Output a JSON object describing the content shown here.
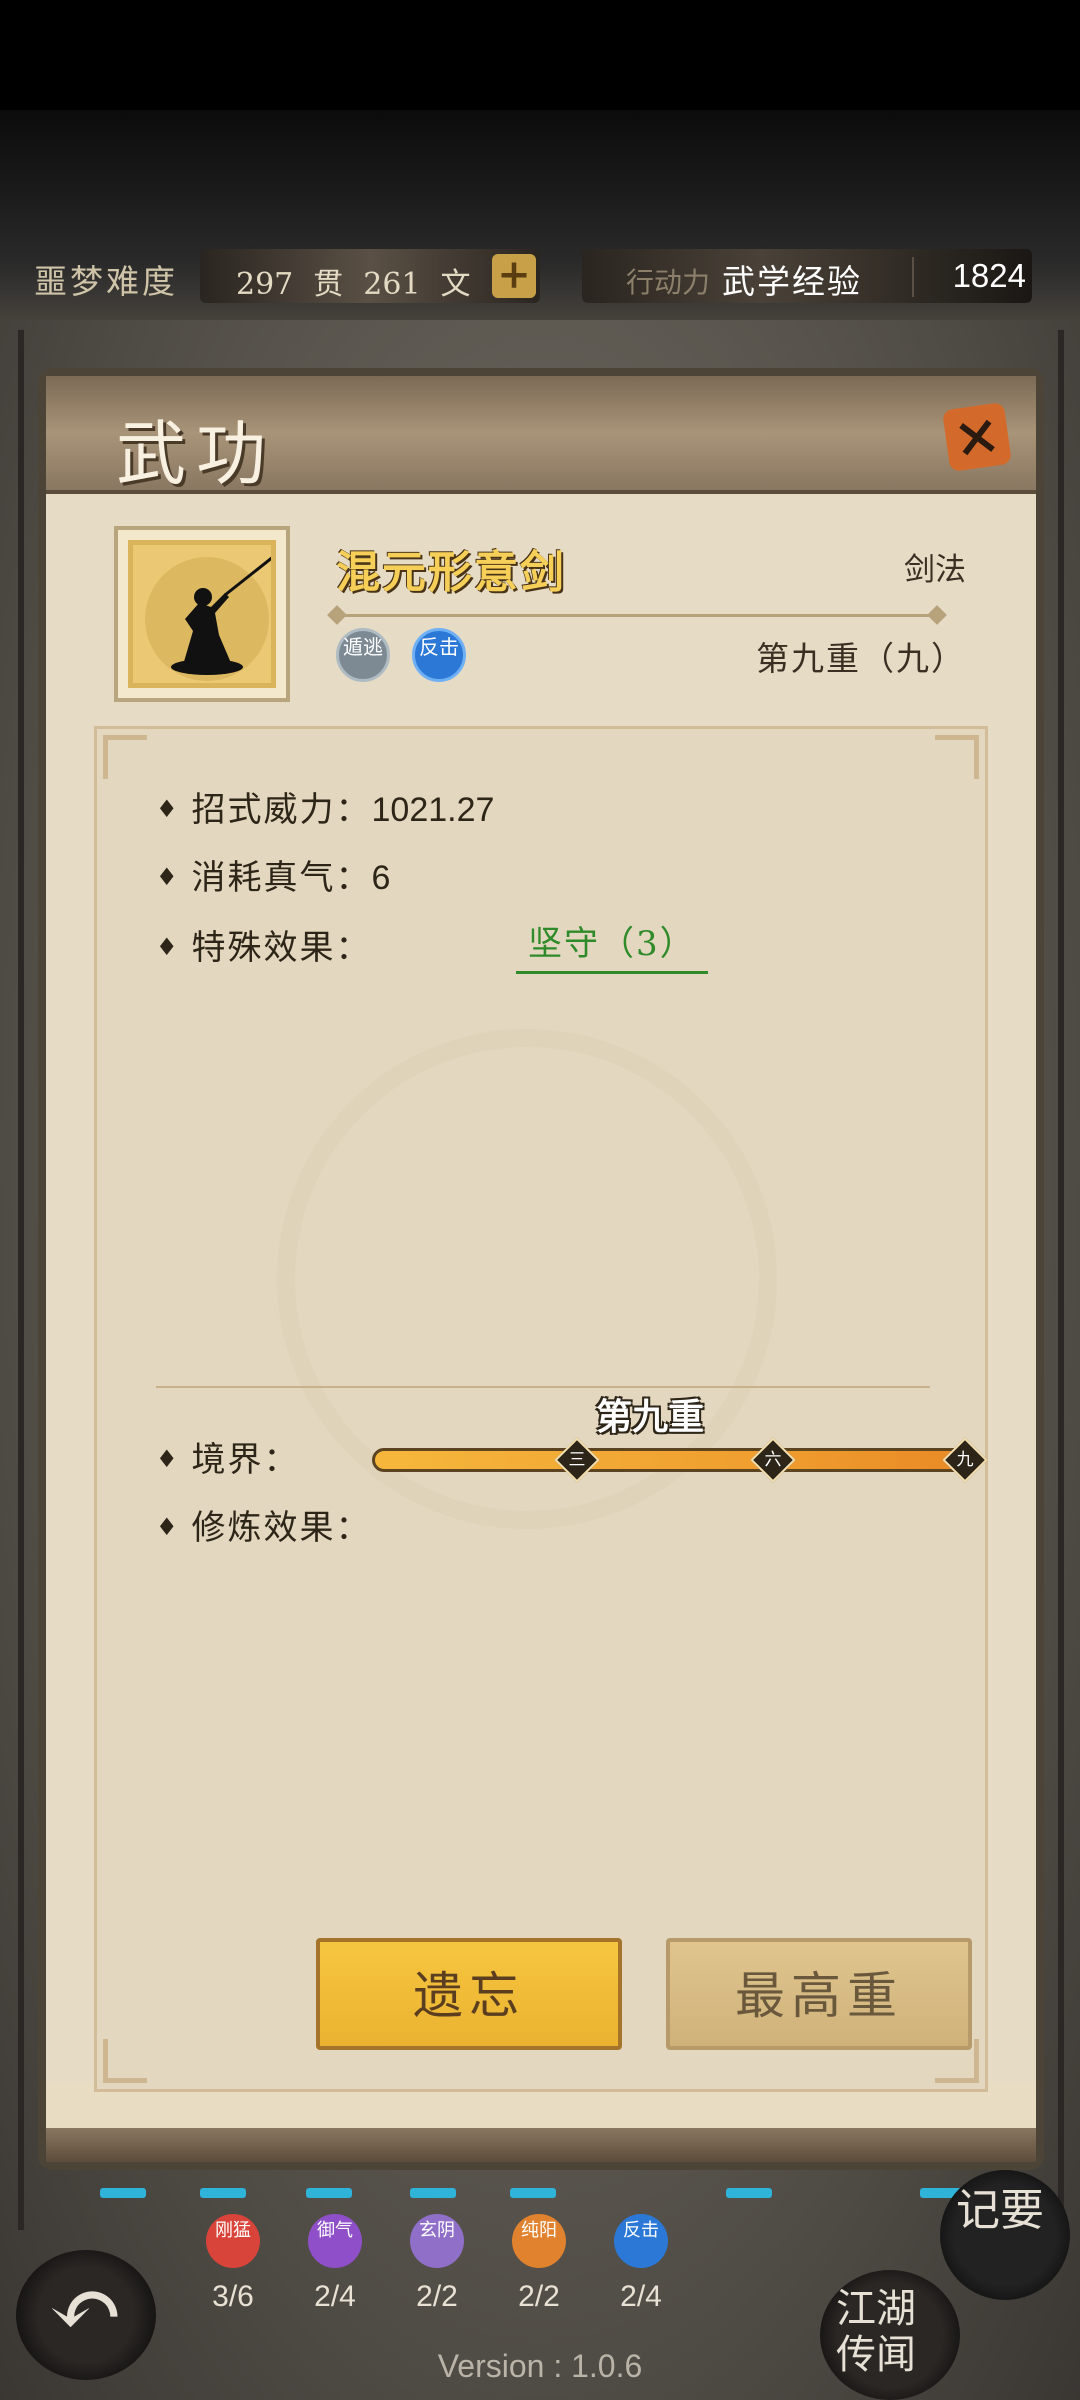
{
  "status_bar": {
    "difficulty": "噩梦难度",
    "money_guan": "297",
    "guan_unit": "贯",
    "money_wen": "261",
    "wen_unit": "文",
    "plus_label": "+",
    "action_label": "行动力",
    "exp_label": "武学经验",
    "exp_value": "1824"
  },
  "modal": {
    "title": "武功",
    "close_label": "×",
    "skill": {
      "name": "混元形意剑",
      "type": "剑法",
      "tags": [
        "遁逃",
        "反击"
      ],
      "level_text": "第九重（九）"
    },
    "stats": {
      "power_label": "招式威力：",
      "power_value": "1021.27",
      "cost_label": "消耗真气：",
      "cost_value": "6",
      "effect_label": "特殊效果：",
      "effect_value": "坚守（3）"
    },
    "realm": {
      "label": "境界：",
      "current": "第九重",
      "progress": 1.0,
      "ticks": [
        "三",
        "六",
        "九"
      ]
    },
    "training_label": "修炼效果：",
    "buttons": {
      "forget": "遗忘",
      "max": "最高重"
    }
  },
  "bottom_bar": {
    "tags": [
      {
        "name": "刚猛",
        "count": "3/6",
        "color": "#d8443a"
      },
      {
        "name": "御气",
        "count": "2/4",
        "color": "#8f4fc8"
      },
      {
        "name": "玄阴",
        "count": "2/2",
        "color": "#8f6fc8"
      },
      {
        "name": "纯阳",
        "count": "2/2",
        "color": "#e0822e"
      },
      {
        "name": "反击",
        "count": "2/4",
        "color": "#2b78d6"
      }
    ],
    "notes_label": "记要",
    "lore_label": "江湖传闻",
    "back_icon": "↶",
    "version": "Version : 1.0.6"
  }
}
